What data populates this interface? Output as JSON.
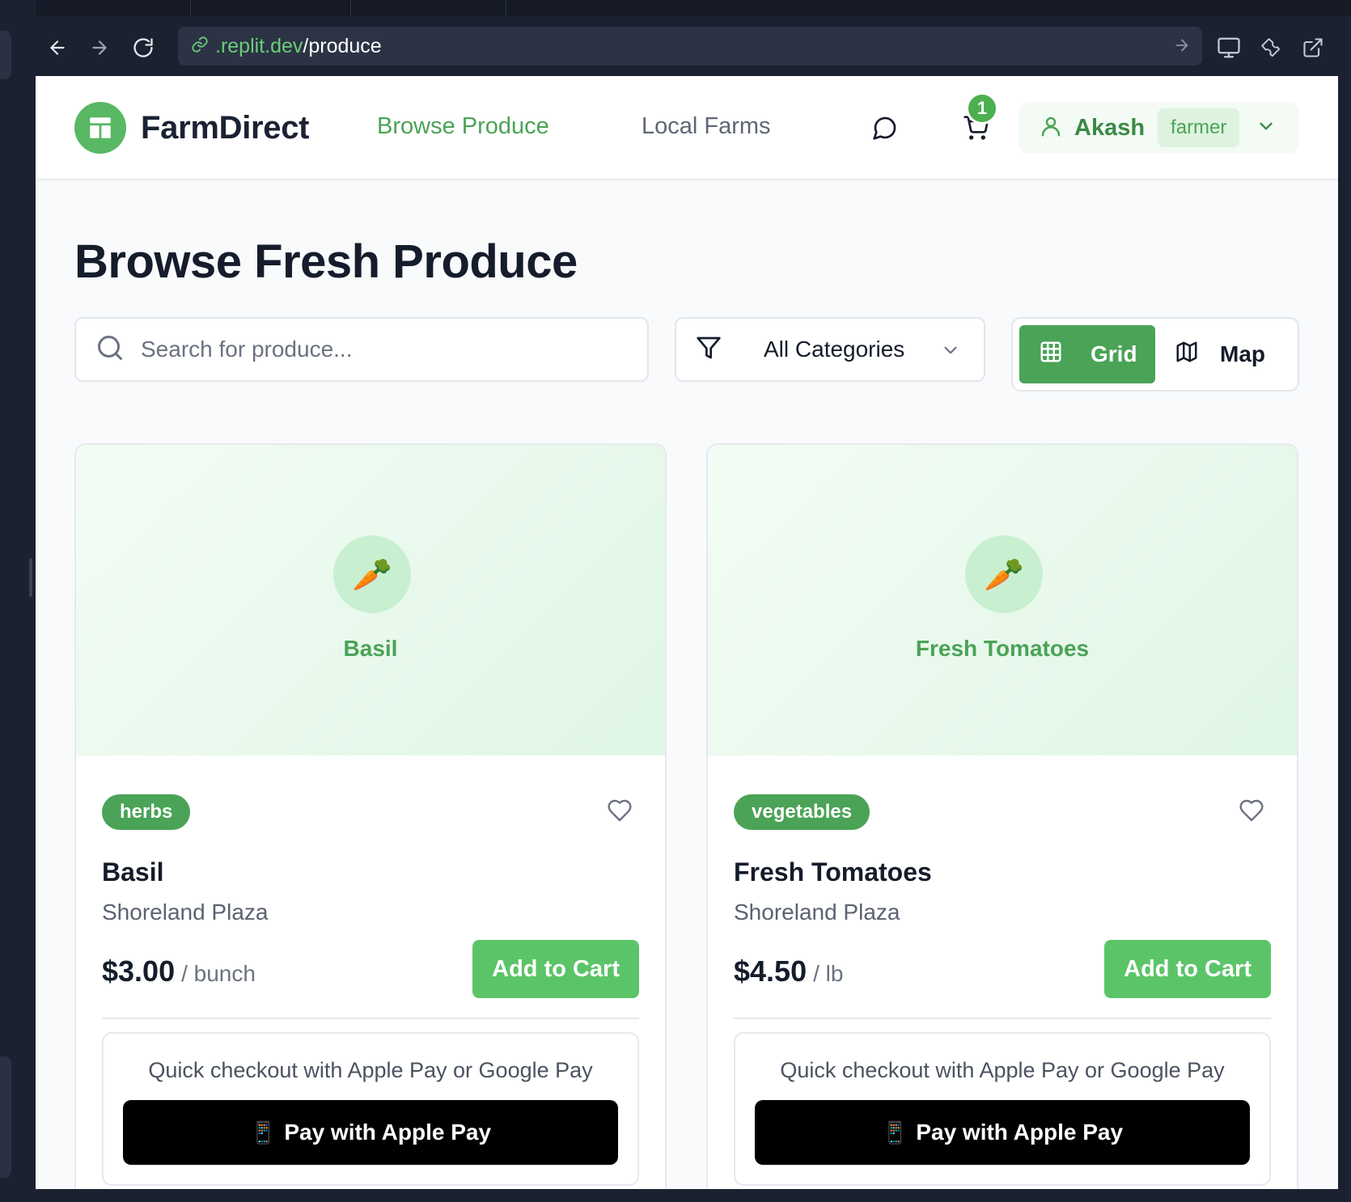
{
  "browser": {
    "url_host": ".replit.dev",
    "url_path": "/produce"
  },
  "header": {
    "brand": "FarmDirect",
    "nav": [
      "Browse Produce",
      "Local Farms"
    ],
    "cart_count": "1",
    "user_name": "Akash",
    "user_role": "farmer"
  },
  "page": {
    "title": "Browse Fresh Produce",
    "search_placeholder": "Search for produce...",
    "category_select": "All Categories",
    "view_grid": "Grid",
    "view_map": "Map"
  },
  "products": [
    {
      "name": "Basil",
      "category": "herbs",
      "farm": "Shoreland Plaza",
      "price": "$3.00",
      "unit": "/ bunch",
      "add_label": "Add to Cart",
      "checkout_text": "Quick checkout with Apple Pay or Google Pay",
      "pay_label": "Pay with Apple Pay",
      "emoji": "🥕"
    },
    {
      "name": "Fresh Tomatoes",
      "category": "vegetables",
      "farm": "Shoreland Plaza",
      "price": "$4.50",
      "unit": "/ lb",
      "add_label": "Add to Cart",
      "checkout_text": "Quick checkout with Apple Pay or Google Pay",
      "pay_label": "Pay with Apple Pay",
      "emoji": "🥕"
    }
  ],
  "colors": {
    "brand_green": "#4aa356",
    "button_green": "#5cc468",
    "text_dark": "#151c2b"
  }
}
